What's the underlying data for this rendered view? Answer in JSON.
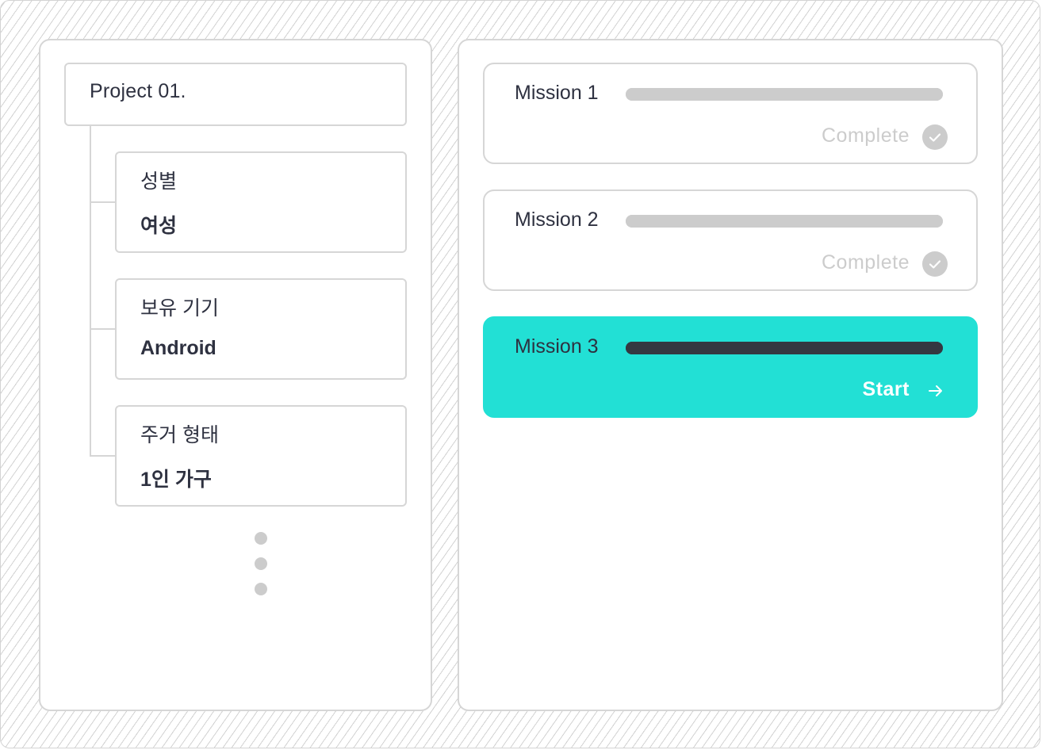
{
  "project": {
    "title": "Project 01."
  },
  "attributes": [
    {
      "label": "성별",
      "value": "여성"
    },
    {
      "label": "보유 기기",
      "value": "Android"
    },
    {
      "label": "주거 형태",
      "value": "1인 가구"
    }
  ],
  "missions": [
    {
      "title": "Mission 1",
      "progress": 1.0,
      "status": "Complete",
      "state": "complete",
      "icon": "check-circle-icon"
    },
    {
      "title": "Mission 2",
      "progress": 1.0,
      "status": "Complete",
      "state": "complete",
      "icon": "check-circle-icon"
    },
    {
      "title": "Mission 3",
      "progress": 1.0,
      "status": "Start",
      "state": "active",
      "icon": "arrow-right-icon"
    }
  ],
  "colors": {
    "accent": "#22e0d5",
    "text": "#2e3140",
    "muted": "#cccccc",
    "border": "#d6d6d6",
    "active_bar": "#343841"
  }
}
